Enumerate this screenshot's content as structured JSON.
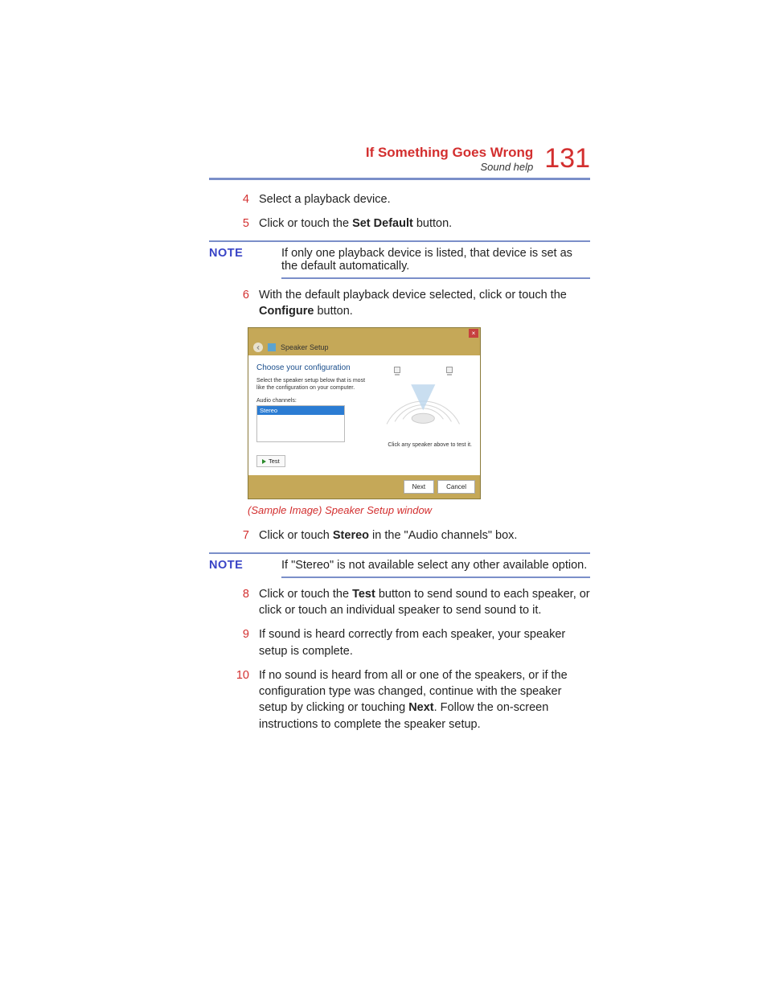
{
  "header": {
    "title": "If Something Goes Wrong",
    "subtitle": "Sound help",
    "page_number": "131"
  },
  "steps_a": [
    {
      "num": "4",
      "text": "Select a playback device."
    },
    {
      "num": "5",
      "text_before": "Click or touch the ",
      "bold": "Set Default",
      "text_after": " button."
    }
  ],
  "note1": {
    "label": "NOTE",
    "text": "If only one playback device is listed, that device is set as the default automatically."
  },
  "steps_b": [
    {
      "num": "6",
      "text_before": "With the default playback device selected, click or touch the ",
      "bold": "Configure",
      "text_after": " button."
    }
  ],
  "dialog": {
    "close": "×",
    "title": "Speaker Setup",
    "heading": "Choose your configuration",
    "description": "Select the speaker setup below that is most like the configuration on your computer.",
    "list_label": "Audio channels:",
    "list_item": "Stereo",
    "test": "Test",
    "hint": "Click any speaker above to test it.",
    "next": "Next",
    "cancel": "Cancel"
  },
  "caption": "(Sample Image) Speaker Setup window",
  "steps_c": [
    {
      "num": "7",
      "text_before": "Click or touch ",
      "bold": "Stereo",
      "text_after": " in the \"Audio channels\" box."
    }
  ],
  "note2": {
    "label": "NOTE",
    "text": "If \"Stereo\" is not available select any other available option."
  },
  "steps_d": [
    {
      "num": "8",
      "text_before": "Click or touch the ",
      "bold": "Test",
      "text_after": " button to send sound to each speaker, or click or touch an individual speaker to send sound to it."
    },
    {
      "num": "9",
      "text": "If sound is heard correctly from each speaker, your speaker setup is complete."
    },
    {
      "num": "10",
      "text_before": "If no sound is heard from all or one of the speakers, or if the configuration type was changed, continue with the speaker setup by clicking or touching ",
      "bold": "Next",
      "text_after": ". Follow the on-screen instructions to complete the speaker setup."
    }
  ]
}
